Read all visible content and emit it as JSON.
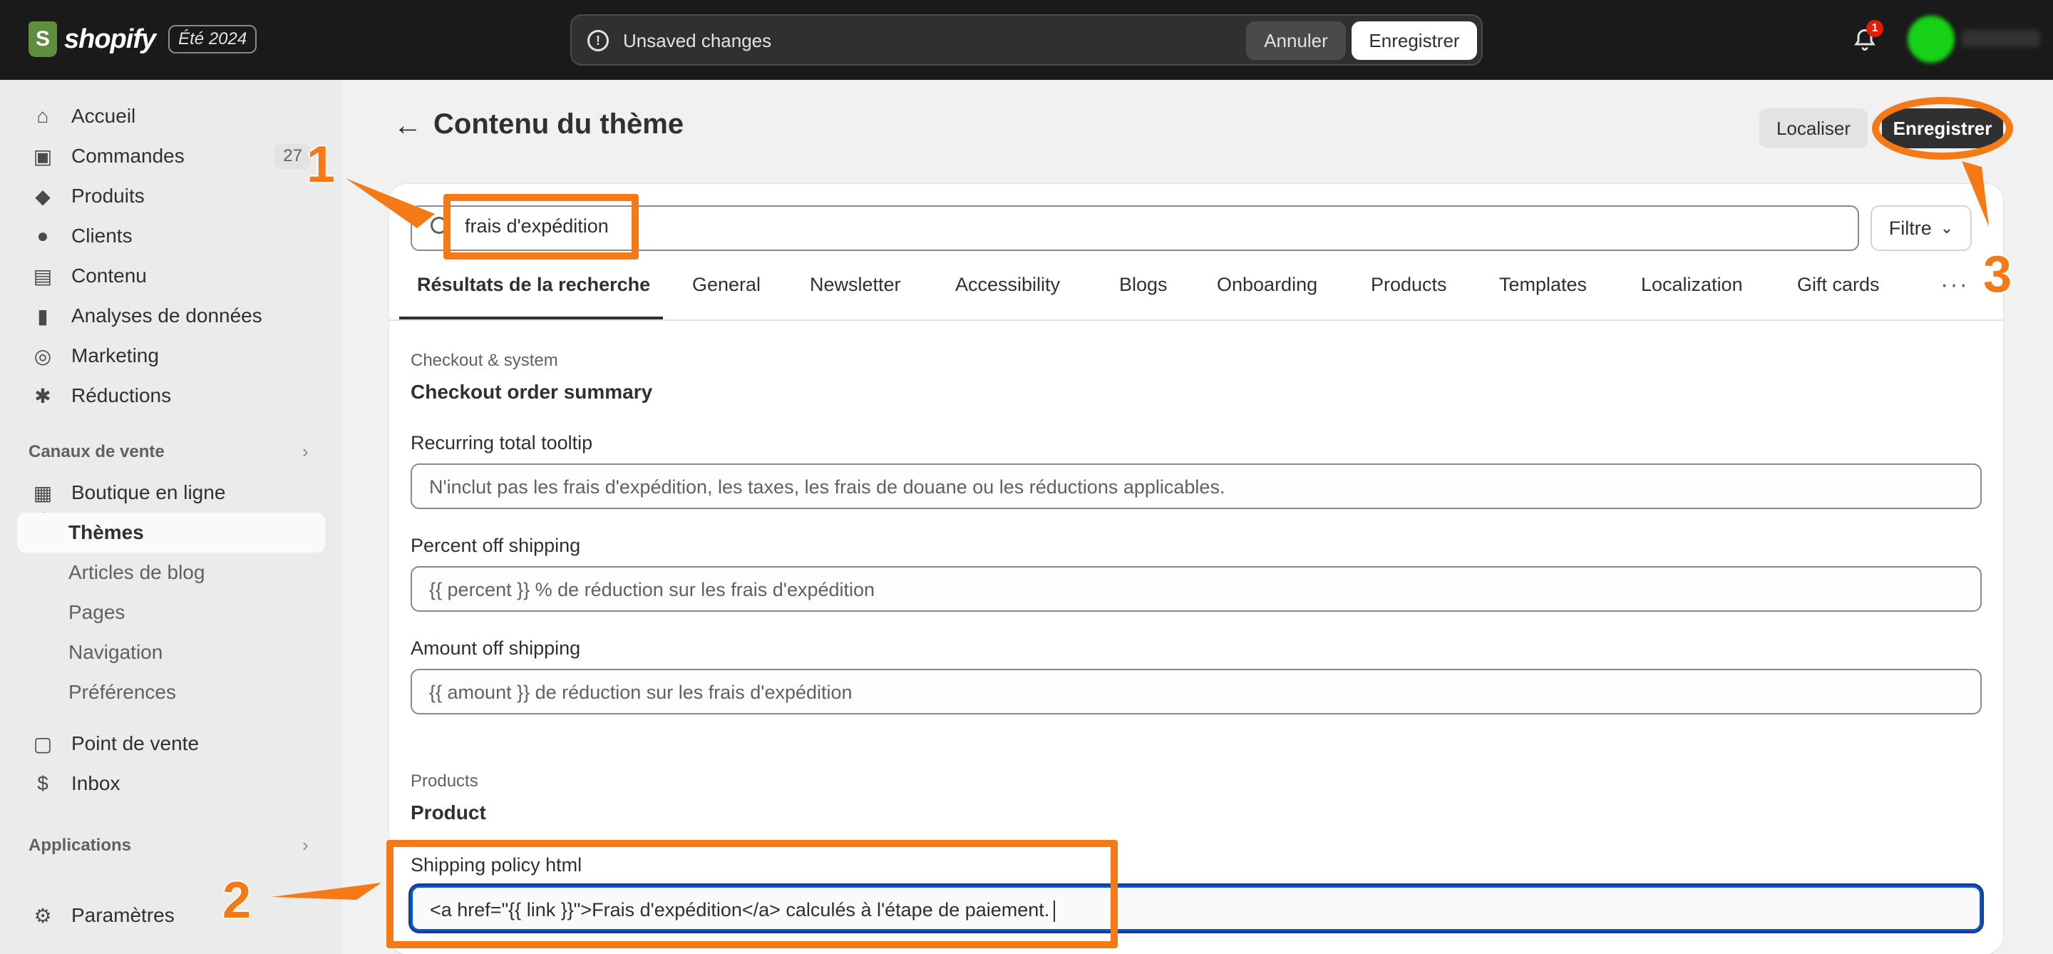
{
  "topbar": {
    "brand": "shopify",
    "edition": "Été 2024",
    "unsaved_text": "Unsaved changes",
    "cancel_label": "Annuler",
    "save_label": "Enregistrer",
    "notification_count": "1"
  },
  "sidebar": {
    "items": [
      {
        "label": "Accueil",
        "icon": "home-icon"
      },
      {
        "label": "Commandes",
        "icon": "inbox-icon",
        "count": "27"
      },
      {
        "label": "Produits",
        "icon": "tag-icon"
      },
      {
        "label": "Clients",
        "icon": "person-icon"
      },
      {
        "label": "Contenu",
        "icon": "image-icon"
      },
      {
        "label": "Analyses de données",
        "icon": "bar-chart-icon"
      },
      {
        "label": "Marketing",
        "icon": "target-icon"
      },
      {
        "label": "Réductions",
        "icon": "discount-icon"
      }
    ],
    "sales_channels_title": "Canaux de vente",
    "online_store": "Boutique en ligne",
    "sub_items": [
      "Thèmes",
      "Articles de blog",
      "Pages",
      "Navigation",
      "Préférences"
    ],
    "pos": "Point de vente",
    "inbox": "Inbox",
    "apps_title": "Applications",
    "settings": "Paramètres"
  },
  "page": {
    "title": "Contenu du thème",
    "localize_label": "Localiser",
    "save_label": "Enregistrer"
  },
  "search": {
    "value": "frais d'expédition",
    "filter_label": "Filtre"
  },
  "tabs": [
    "Résultats de la recherche",
    "General",
    "Newsletter",
    "Accessibility",
    "Blogs",
    "Onboarding",
    "Products",
    "Templates",
    "Localization",
    "Gift cards"
  ],
  "sections": {
    "checkout": {
      "category": "Checkout & system",
      "title": "Checkout order summary",
      "fields": [
        {
          "label": "Recurring total tooltip",
          "value": "N'inclut pas les frais d'expédition, les taxes, les frais de douane ou les réductions applicables."
        },
        {
          "label": "Percent off shipping",
          "value": "{{ percent }} % de réduction sur les frais d'expédition"
        },
        {
          "label": "Amount off shipping",
          "value": "{{ amount }} de réduction sur les frais d'expédition"
        }
      ]
    },
    "products": {
      "category": "Products",
      "title": "Product",
      "field": {
        "label": "Shipping policy html",
        "value": "<a href=\"{{ link }}\">Frais d'expédition</a> calculés à l'étape de paiement."
      }
    }
  },
  "annotations": [
    "1",
    "2",
    "3"
  ],
  "colors": {
    "annotation": "#f57a16",
    "topbar": "#1a1a1a",
    "focus": "#005bd3"
  }
}
